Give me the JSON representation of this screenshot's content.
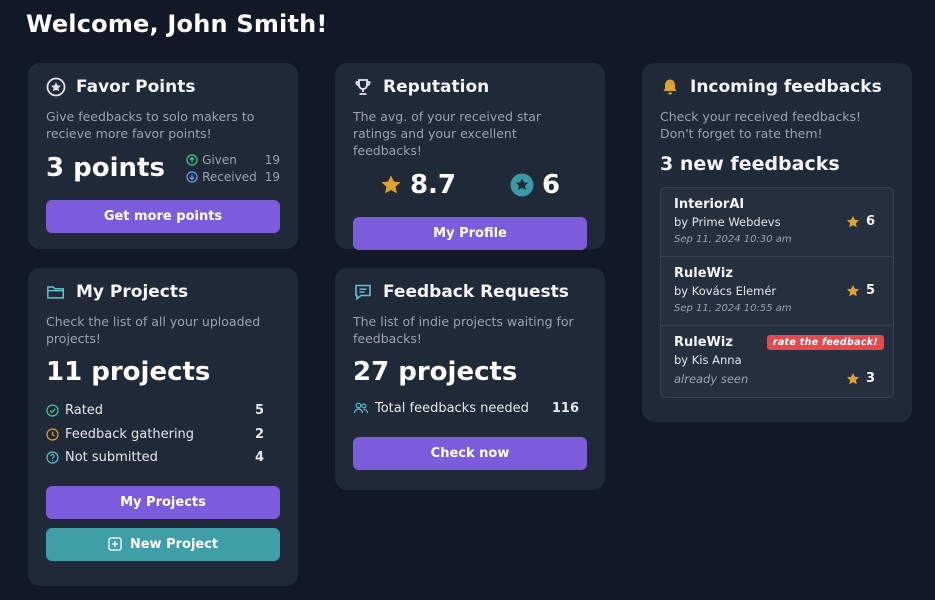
{
  "page": {
    "welcome": "Welcome, John Smith!"
  },
  "colors": {
    "background": "#111827",
    "card": "#1f2937",
    "primary": "#7c5cdb",
    "secondary": "#3f9ea6",
    "star": "#e0a22e",
    "badge": "#e5484d"
  },
  "favor": {
    "title": "Favor Points",
    "description": "Give feedbacks to solo makers to recieve more favor points!",
    "points": "3 points",
    "given_label": "Given",
    "given_value": "19",
    "received_label": "Received",
    "received_value": "19",
    "button": "Get more points",
    "icon": "star-circle-icon"
  },
  "reputation": {
    "title": "Reputation",
    "description": "The avg. of your received star ratings and your excellent feedbacks!",
    "avg_rating": "8.7",
    "excellent_count": "6",
    "button": "My Profile",
    "icon": "trophy-icon"
  },
  "incoming": {
    "title": "Incoming feedbacks",
    "description": "Check your received feedbacks! Don't forget to rate them!",
    "new_count": "3 new feedbacks",
    "icon": "bell-icon",
    "items": [
      {
        "name": "InteriorAI",
        "by": "by Prime Webdevs",
        "date": "Sep 11, 2024 10:30 am",
        "rating": "6"
      },
      {
        "name": "RuleWiz",
        "by": "by Kovács Elemér",
        "date": "Sep 11, 2024 10:55 am",
        "rating": "5"
      },
      {
        "name": "RuleWiz",
        "by": "by Kis Anna",
        "seen": "already seen",
        "rating": "3",
        "badge": "rate the feedback!"
      }
    ]
  },
  "projects": {
    "title": "My Projects",
    "description": "Check the list of all your uploaded projects!",
    "count": "11 projects",
    "stats": [
      {
        "label": "Rated",
        "value": "5"
      },
      {
        "label": "Feedback gathering",
        "value": "2"
      },
      {
        "label": "Not submitted",
        "value": "4"
      }
    ],
    "button_primary": "My Projects",
    "button_new": "New Project",
    "icon": "folder-icon"
  },
  "requests": {
    "title": "Feedback Requests",
    "description": "The list of indie projects waiting for feedbacks!",
    "count": "27 projects",
    "total_label": "Total feedbacks needed",
    "total_value": "116",
    "button": "Check now",
    "icon": "chat-icon"
  }
}
